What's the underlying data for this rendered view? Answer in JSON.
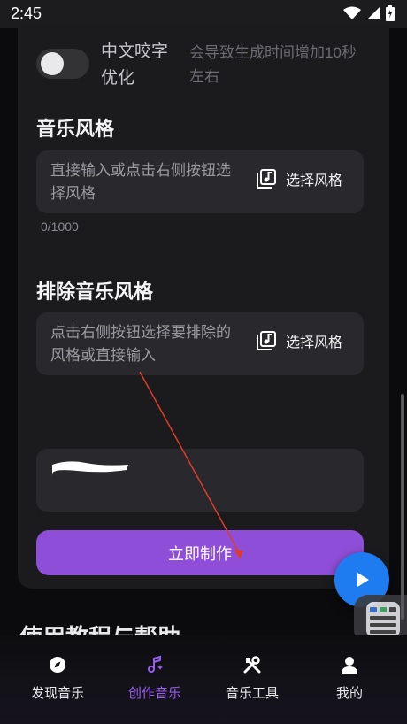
{
  "status_bar": {
    "time": "2:45"
  },
  "options": {
    "label": "中文咬字优化",
    "hint": "会导致生成时间增加10秒左右"
  },
  "music_style": {
    "title": "音乐风格",
    "placeholder": "直接输入或点击右侧按钮选择风格",
    "pick_label": "选择风格",
    "counter": "0/1000"
  },
  "exclude_style": {
    "title": "排除音乐风格",
    "placeholder": "点击右侧按钮选择要排除的风格或直接输入",
    "pick_label": "选择风格"
  },
  "create_button": "立即制作",
  "peek_heading": "使用教程与帮助",
  "tabs": [
    {
      "label": "发现音乐",
      "icon": "compass-icon",
      "active": false
    },
    {
      "label": "创作音乐",
      "icon": "music-note-sparkle-icon",
      "active": true
    },
    {
      "label": "音乐工具",
      "icon": "tools-icon",
      "active": false
    },
    {
      "label": "我的",
      "icon": "person-icon",
      "active": false
    }
  ],
  "colors": {
    "accent": "#8f4ed8",
    "fab": "#1e7cf0",
    "background": "#0b0b0d"
  }
}
